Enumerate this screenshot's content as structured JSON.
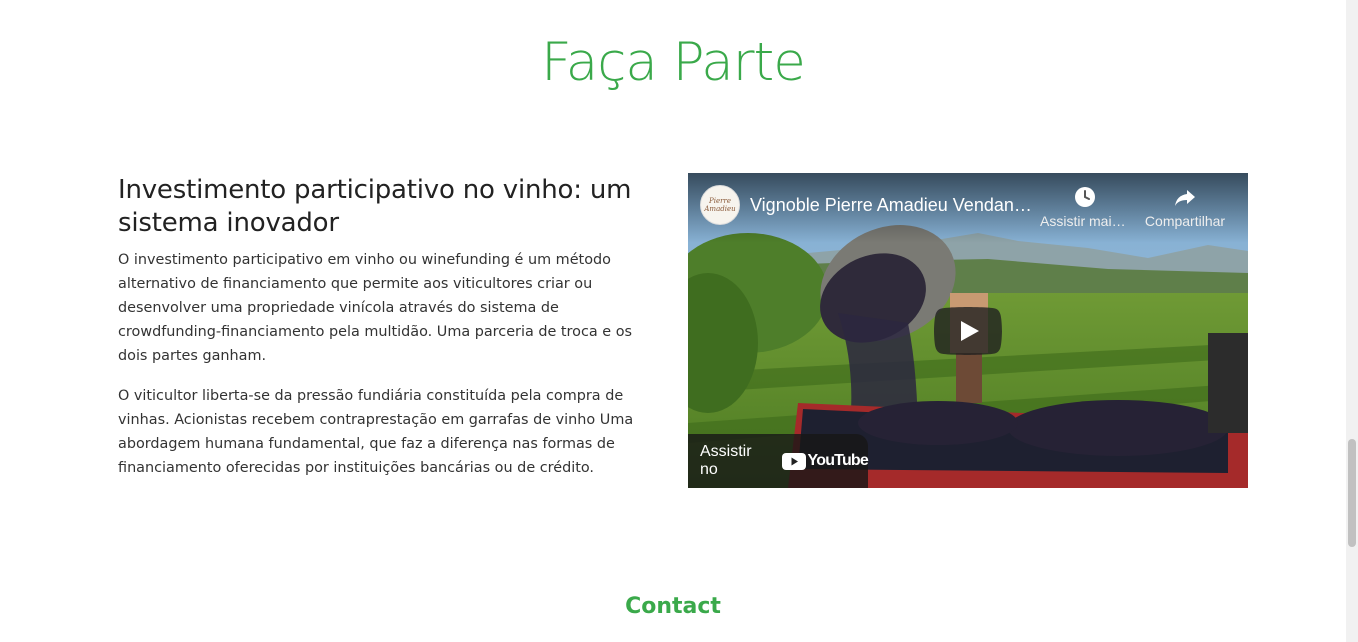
{
  "section": {
    "title": "Faça Parte"
  },
  "article": {
    "heading": "Investimento participativo no vinho: um sistema inovador",
    "paragraphs": [
      "O investimento participativo em vinho ou winefunding é um método alternativo de financiamento que permite aos viticultores criar ou desenvolver uma propriedade vinícola através do sistema de crowdfunding-financiamento pela multidão. Uma parceria de troca e os dois partes ganham.",
      "O viticultor liberta-se da pressão fundiária constituída pela compra de vinhas. Acionistas recebem contraprestação em garrafas de vinho Uma abordagem humana fundamental, que faz a diferença nas formas de financiamento oferecidas por instituições bancárias ou de crédito."
    ]
  },
  "video": {
    "title": "Vignoble Pierre Amadieu Vendanges",
    "watch_later_label": "Assistir mais tarde",
    "share_label": "Compartilhar",
    "watch_on_label": "Assistir no",
    "platform_name": "YouTube",
    "icons": {
      "watch_later": "clock-icon",
      "share": "share-arrow-icon",
      "play": "play-icon",
      "logo": "youtube-logo-icon"
    }
  },
  "contact": {
    "title": "Contact"
  },
  "colors": {
    "accent_green": "#3aa94a",
    "youtube_red": "#ff0000"
  }
}
